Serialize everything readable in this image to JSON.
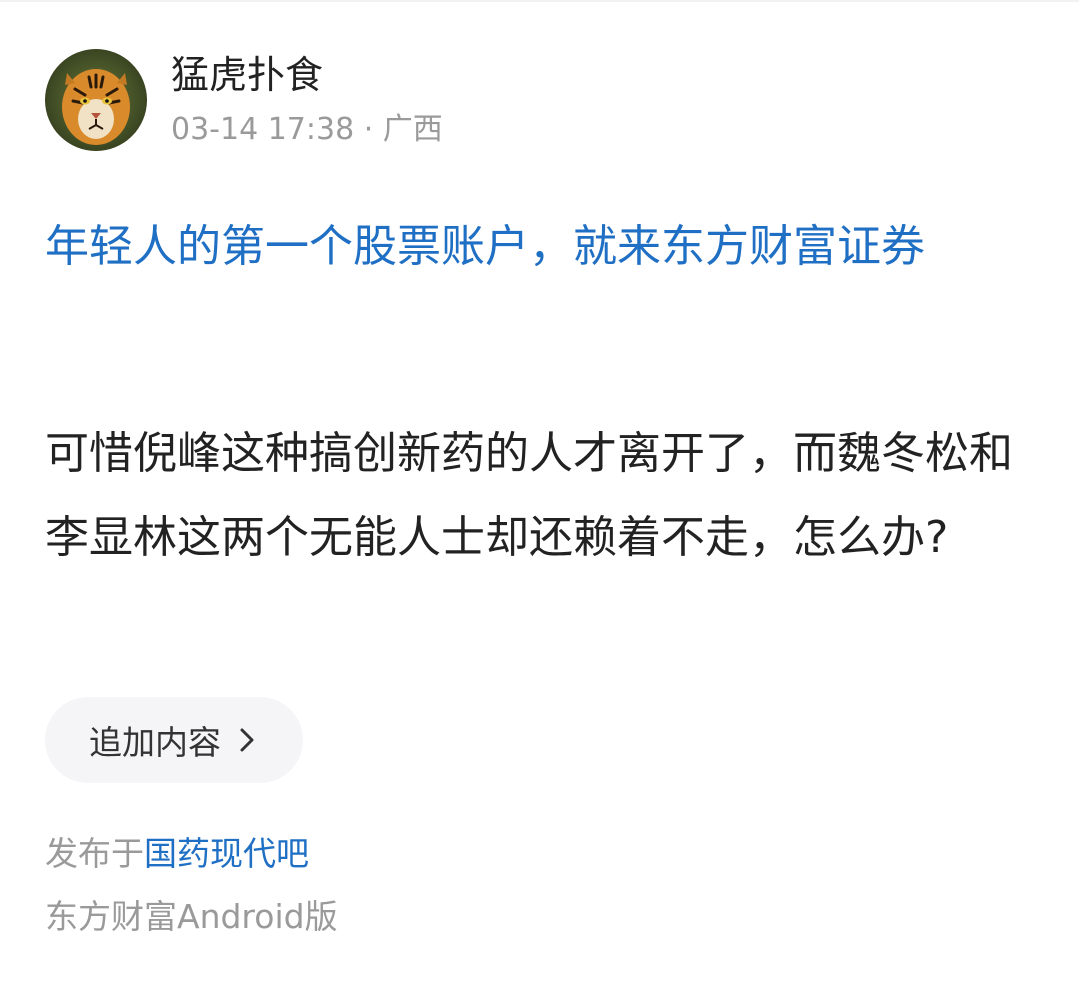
{
  "author": {
    "name": "猛虎扑食",
    "timestamp": "03-14 17:38",
    "separator": " · ",
    "location": "广西",
    "avatar_icon": "tiger-avatar-icon"
  },
  "post": {
    "headline": "年轻人的第一个股票账户，就来东方财富证券",
    "body": "可惜倪峰这种搞创新药的人才离开了，而魏冬松和李显林这两个无能人士却还赖着不走，怎么办?"
  },
  "actions": {
    "append_label": "追加内容",
    "append_icon": "chevron-right-icon"
  },
  "footer": {
    "posted_prefix": "发布于",
    "forum_name": "国药现代吧",
    "source": "东方财富Android版"
  },
  "colors": {
    "link_blue": "#1f6fc4",
    "text_dark": "#222222",
    "text_gray": "#9a9a9a",
    "pill_bg": "#f5f5f7"
  }
}
